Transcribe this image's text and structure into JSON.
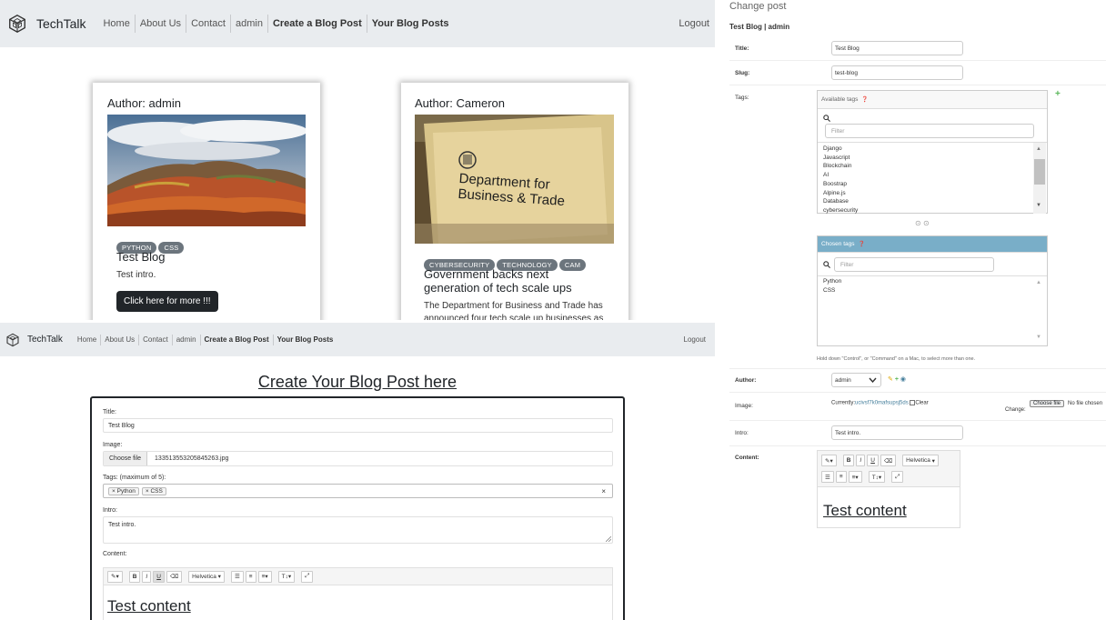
{
  "site": {
    "brand": "TechTalk",
    "nav": [
      "Home",
      "About Us",
      "Contact",
      "admin",
      "Create a Blog Post",
      "Your Blog Posts"
    ],
    "logout": "Logout"
  },
  "home": {
    "cards": [
      {
        "author": "Author: admin",
        "tags": [
          "PYTHON",
          "CSS"
        ],
        "title": "Test Blog",
        "intro": "Test intro.",
        "button": "Click here for more !!!"
      },
      {
        "author": "Author: Cameron",
        "image_sign_line1": "Department for",
        "image_sign_line2": "Business & Trade",
        "tags": [
          "CYBERSECURITY",
          "TECHNOLOGY",
          "CAM"
        ],
        "title_line1": "Government backs next",
        "title_line2": "generation of tech scale ups",
        "intro_line1": "The Department for Business and Trade has",
        "intro_line2": "announced four tech scale up businesses as"
      }
    ]
  },
  "create": {
    "heading": "Create Your Blog Post here",
    "title_label": "Title:",
    "title_value": "Test Blog",
    "image_label": "Image:",
    "choose_file": "Choose file",
    "file_name": "133513553205845263.jpg",
    "tags_label": "Tags: (maximum of 5):",
    "tags": [
      "Python",
      "CSS"
    ],
    "tag_remove": "×",
    "tags_clear": "×",
    "intro_label": "Intro:",
    "intro_value": "Test intro.",
    "content_label": "Content:",
    "font_name": "Helvetica",
    "content_text": "Test content"
  },
  "admin": {
    "page_title": "Change post",
    "subtitle": "Test Blog | admin",
    "title_label": "Title:",
    "title_value": "Test Blog",
    "slug_label": "Slug:",
    "slug_value": "test-blog",
    "tags_label": "Tags:",
    "available_tags_label": "Available tags",
    "filter_placeholder": "Filter",
    "available_tags": [
      "Django",
      "Javascript",
      "Blockchain",
      "AI",
      "Boostrap",
      "Alpine.js",
      "Database",
      "cybersecurity"
    ],
    "chosen_tags_label": "Chosen tags",
    "chosen_tags": [
      "Python",
      "CSS"
    ],
    "help_text": "Hold down \"Control\", or \"Command\" on a Mac, to select more than one.",
    "author_label": "Author:",
    "author_value": "admin",
    "image_label": "Image:",
    "currently_label": "Currently:",
    "currently_value": "ucivsf7k0mafsupsj5ds",
    "clear_label": "Clear",
    "change_label": "Change:",
    "choose_file": "Choose file",
    "no_file": "No file chosen",
    "intro_label": "Intro:",
    "intro_value": "Test intro.",
    "content_label": "Content:",
    "font_name": "Helvetica",
    "content_text": "Test content"
  },
  "colors": {
    "navbar_bg": "#e9ecef",
    "tag_pill_bg": "#6c757d",
    "button_dark": "#212529",
    "admin_chosen_header": "#79aec8",
    "admin_link": "#447e9b",
    "admin_add_green": "#5cb85c"
  }
}
